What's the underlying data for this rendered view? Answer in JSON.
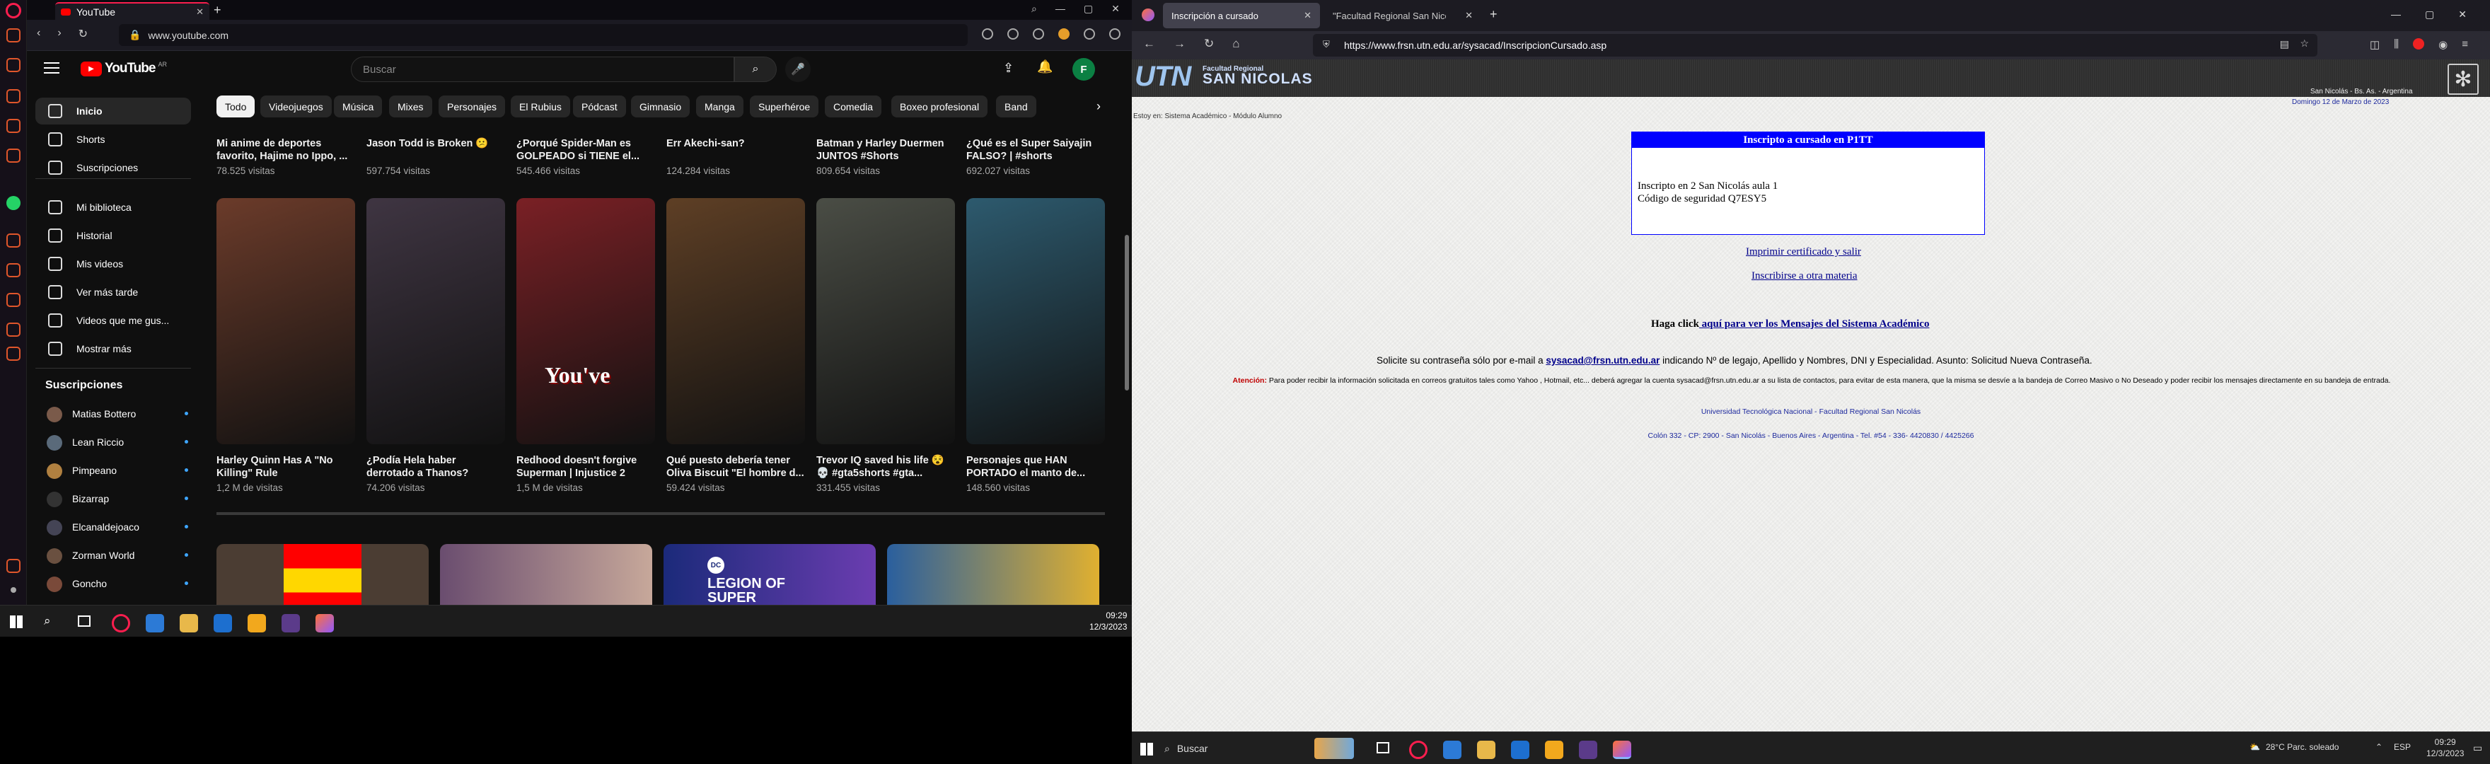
{
  "left_window": {
    "tab_title": "YouTube",
    "url": "www.youtube.com"
  },
  "youtube": {
    "country": "AR",
    "logo_text": "YouTube",
    "search_placeholder": "Buscar",
    "avatar_letter": "F",
    "nav": [
      {
        "label": "Inicio",
        "icon": "home-icon"
      },
      {
        "label": "Shorts",
        "icon": "shorts-icon"
      },
      {
        "label": "Suscripciones",
        "icon": "subscriptions-icon"
      },
      {
        "label": "Mi biblioteca",
        "icon": "library-icon"
      },
      {
        "label": "Historial",
        "icon": "history-icon"
      },
      {
        "label": "Mis videos",
        "icon": "my-videos-icon"
      },
      {
        "label": "Ver más tarde",
        "icon": "watch-later-icon"
      },
      {
        "label": "Videos que me gus...",
        "icon": "liked-icon"
      },
      {
        "label": "Mostrar más",
        "icon": "chevron-down-icon"
      }
    ],
    "subscriptions_title": "Suscripciones",
    "subscriptions": [
      "Matias Bottero",
      "Lean Riccio",
      "Pimpeano",
      "Bizarrap",
      "Elcanaldejoaco",
      "Zorman World",
      "Goncho"
    ],
    "chips": [
      "Todo",
      "Videojuegos",
      "Música",
      "Mixes",
      "Personajes",
      "El Rubius",
      "Pódcast",
      "Gimnasio",
      "Manga",
      "Superhéroe",
      "Comedia",
      "Boxeo profesional",
      "Band"
    ],
    "top_row": [
      {
        "title": "Mi anime de deportes favorito, Hajime no Ippo, ...",
        "views": "78.525 visitas"
      },
      {
        "title": "Jason Todd is Broken 😕",
        "views": "597.754 visitas"
      },
      {
        "title": "¿Porqué Spider-Man es GOLPEADO si TIENE el...",
        "views": "545.466 visitas"
      },
      {
        "title": "Err Akechi-san?",
        "views": "124.284 visitas"
      },
      {
        "title": "Batman y Harley Duermen JUNTOS #Shorts",
        "views": "809.654 visitas"
      },
      {
        "title": "¿Qué es el Super Saiyajin FALSO? | #shorts",
        "views": "692.027 visitas"
      }
    ],
    "shorts": [
      {
        "title": "Harley Quinn Has A \"No Killing\" Rule",
        "views": "1,2 M de visitas",
        "color": "#6b3b2a"
      },
      {
        "title": "¿Podía Hela haber derrotado a Thanos?",
        "views": "74.206 visitas",
        "color": "#3f3542"
      },
      {
        "title": "Redhood doesn't forgive Superman | Injustice 2",
        "views": "1,5 M de visitas",
        "overlay": "You've",
        "color": "#7a2025"
      },
      {
        "title": "Qué puesto debería tener Oliva Biscuit \"El hombre d...",
        "views": "59.424 visitas",
        "color": "#5e3f25"
      },
      {
        "title": "Trevor IQ saved his life 😵 💀 #gta5shorts #gta...",
        "views": "331.455 visitas",
        "color": "#4a4d45"
      },
      {
        "title": "Personajes que HAN PORTADO el manto de...",
        "views": "148.560 visitas",
        "color": "#2d5a6e"
      }
    ],
    "bottom_thumb_text": "LEGION OF SUPER HEROES",
    "bottom_thumb_badge": "DC"
  },
  "left_taskbar": {
    "time": "09:29",
    "date": "12/3/2023"
  },
  "right_window": {
    "tabs": [
      "Inscripción a cursado",
      "\"Facultad Regional San Nicolás - Ur"
    ],
    "url": "https://www.frsn.utn.edu.ar/sysacad/InscripcionCursado.asp"
  },
  "utn": {
    "brand": "UTN",
    "brand_sub_top": "Facultad Regional",
    "brand_sub": "SAN NICOLAS",
    "location": "San Nicolás - Bs. As. - Argentina",
    "date_line": "Domingo 12 de Marzo de 2023",
    "breadcrumb": "Estoy en: Sistema Académico - Módulo Alumno",
    "box_title": "Inscripto a cursado en P1TT",
    "box_line1": "Inscripto en 2 San Nicolás aula 1",
    "box_line2": "Código de seguridad Q7ESY5",
    "link_print": "Imprimir certificado y salir",
    "link_other": "Inscribirse a otra materia",
    "messages_pre": "Haga click",
    "messages_link": " aquí para ver los Mensajes del Sistema Académico",
    "contact_pre": "Solicite su contraseña sólo por e-mail a",
    "contact_email": "sysacad@frsn.utn.edu.ar",
    "contact_post": "indicando Nº de legajo, Apellido y Nombres, DNI y Especialidad. Asunto: Solicitud Nueva Contraseña.",
    "attention_label": "Atención:",
    "attention_text": "Para poder recibir la información solicitada en correos gratuitos tales como Yahoo , Hotmail, etc... deberá agregar la cuenta sysacad@frsn.utn.edu.ar a su lista de contactos, para evitar de esta manera, que la misma se desvíe a la bandeja de Correo Masivo o No Deseado y poder recibir los mensajes directamente en su bandeja de entrada.",
    "footer1": "Universidad Tecnológica Nacional - Facultad Regional San Nicolás",
    "footer2": "Colón 332 - CP: 2900 - San Nicolás - Buenos Aires - Argentina - Tel. #54 - 336- 4420830 / 4425266"
  },
  "right_taskbar": {
    "search": "Buscar",
    "weather": "28°C Parc. soleado",
    "lang": "ESP",
    "time": "09:29",
    "date": "12/3/2023"
  },
  "colors": {
    "youtube_red": "#ff0000",
    "opera_accent": "#fa1e4e",
    "utn_blue": "#0000ff",
    "link_navy": "#00008b",
    "attention_red": "#c00000"
  }
}
